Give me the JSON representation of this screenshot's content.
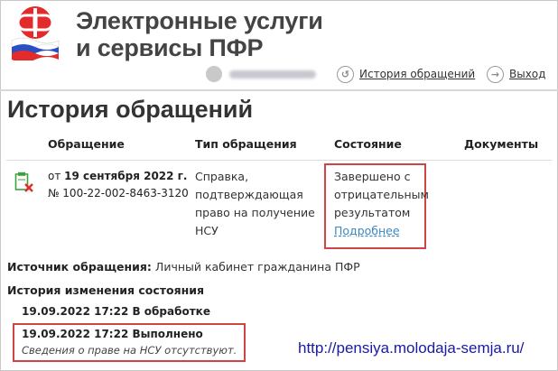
{
  "header": {
    "brand_line1": "Электронные услуги",
    "brand_line2": "и сервисы ПФР",
    "history_link": "История обращений",
    "logout_link": "Выход",
    "logo_text": "ПФР"
  },
  "page": {
    "title": "История обращений"
  },
  "table": {
    "columns": [
      "Обращение",
      "Тип обращения",
      "Состояние",
      "Документы"
    ],
    "rows": [
      {
        "date_prefix": "от ",
        "date": "19 сентября 2022 г.",
        "number": "№ 100-22-002-8463-3120",
        "type_lines": [
          "Справка,",
          "подтверждающая",
          "право на получение",
          "НСУ"
        ],
        "status_lines": [
          "Завершено с",
          "отрицательным",
          "результатом"
        ],
        "details_link": "Подробнее"
      }
    ]
  },
  "source": {
    "label": "Источник обращения:",
    "value": "Личный кабинет гражданина ПФР"
  },
  "history": {
    "title": "История изменения состояния",
    "entries": [
      {
        "text": "19.09.2022 17:22 В обработке"
      },
      {
        "text": "19.09.2022 17:22 Выполнено",
        "note": "Сведения о праве на НСУ отсутствуют."
      }
    ]
  },
  "watermark": "http://pensiya.molodaja-semja.ru/",
  "colors": {
    "highlight": "#cd4545",
    "link": "#3d88bf",
    "watermark": "#1a1aa6",
    "logo_red": "#e32b2b"
  }
}
